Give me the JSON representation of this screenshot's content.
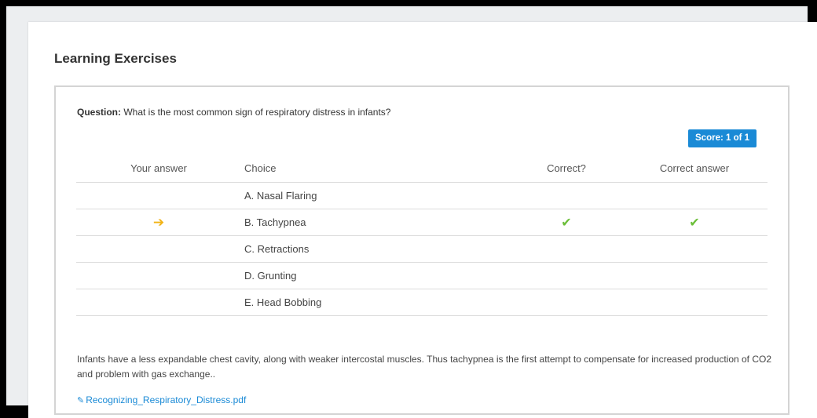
{
  "section": {
    "heading": "Learning Exercises"
  },
  "question": {
    "label": "Question:",
    "text": "What is the most common sign of respiratory distress in infants?"
  },
  "score": {
    "label": "Score: 1 of 1"
  },
  "table": {
    "headers": [
      "Your answer",
      "Choice",
      "Correct?",
      "Correct answer"
    ],
    "rows": [
      {
        "your_answer": "",
        "choice": "A. Nasal Flaring",
        "correct": "",
        "correct_answer": ""
      },
      {
        "your_answer": "arrow-right-icon",
        "choice": "B. Tachypnea",
        "correct": "check-icon",
        "correct_answer": "check-icon"
      },
      {
        "your_answer": "",
        "choice": "C. Retractions",
        "correct": "",
        "correct_answer": ""
      },
      {
        "your_answer": "",
        "choice": "D. Grunting",
        "correct": "",
        "correct_answer": ""
      },
      {
        "your_answer": "",
        "choice": "E. Head Bobbing",
        "correct": "",
        "correct_answer": ""
      }
    ]
  },
  "explanation": "Infants have a less expandable chest cavity, along with weaker intercostal muscles. Thus tachypnea is the first attempt to compensate for increased production of CO2 and problem with gas exchange..",
  "attachment": {
    "icon": "paperclip-icon",
    "filename": "Recognizing_Respiratory_Distress.pdf"
  },
  "colors": {
    "accent": "#1a8ad6",
    "arrow": "#f2b316",
    "check": "#6cbf3a"
  }
}
